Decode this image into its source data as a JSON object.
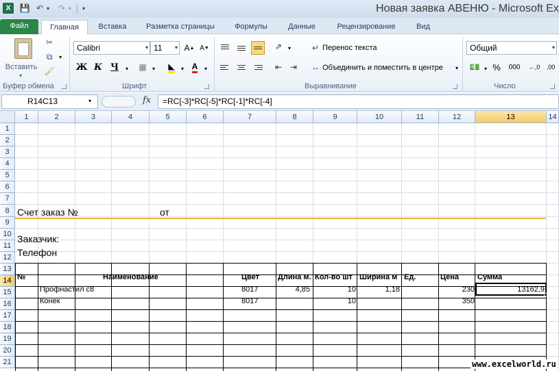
{
  "window": {
    "title": "Новая заявка АВЕНЮ  -  Microsoft Exce"
  },
  "quick_access": {
    "logo": "X"
  },
  "tabs": [
    {
      "label": "Файл"
    },
    {
      "label": "Главная"
    },
    {
      "label": "Вставка"
    },
    {
      "label": "Разметка страницы"
    },
    {
      "label": "Формулы"
    },
    {
      "label": "Данные"
    },
    {
      "label": "Рецензирование"
    },
    {
      "label": "Вид"
    }
  ],
  "ribbon": {
    "clipboard": {
      "label": "Буфер обмена",
      "paste_label": "Вставить"
    },
    "font": {
      "label": "Шрифт",
      "font_name": "Calibri",
      "font_size": "11",
      "bold": "Ж",
      "italic": "К",
      "underline": "Ч"
    },
    "alignment": {
      "label": "Выравнивание",
      "wrap_text": "Перенос текста",
      "merge_center": "Объединить и поместить в центре"
    },
    "number": {
      "label": "Число",
      "format": "Общий",
      "percent": "%",
      "thousands": "000",
      "inc_decimal": "←,0",
      "dec_decimal": ",00"
    }
  },
  "formula_bar": {
    "name_box": "R14C13",
    "fx": "fx",
    "formula": "=RC[-3]*RC[-5]*RC[-1]*RC[-4]"
  },
  "grid": {
    "columns": [
      "1",
      "2",
      "3",
      "4",
      "5",
      "6",
      "7",
      "8",
      "9",
      "10",
      "11",
      "12",
      "13",
      "14"
    ],
    "rows": [
      "1",
      "2",
      "3",
      "4",
      "5",
      "6",
      "7",
      "8",
      "9",
      "10",
      "11",
      "12",
      "13",
      "14",
      "15",
      "16",
      "17",
      "18",
      "19",
      "20",
      "21"
    ],
    "selected_column": "13",
    "selected_row": "14"
  },
  "sheet": {
    "invoice_label": "Счет заказ №",
    "from_label": "от",
    "customer_label": "Заказчик:",
    "phone_label": "Телефон",
    "table_headers": {
      "num": "№",
      "name": "Наименование",
      "color": "Цвет",
      "length": "Длина м.",
      "qty": "Кол-во шт",
      "width": "Ширина м",
      "unit": "Ед.",
      "price": "Цена",
      "sum": "Сумма"
    },
    "rows": [
      {
        "name": "Профнастил с8",
        "color": "8017",
        "length": "4,85",
        "qty": "10",
        "width": "1,18",
        "unit": "",
        "price": "230",
        "sum": "13162,9"
      },
      {
        "name": "Конек",
        "color": "8017",
        "length": "",
        "qty": "10",
        "width": "",
        "unit": "",
        "price": "350",
        "sum": ""
      }
    ]
  },
  "watermark": "www.excelworld.ru"
}
